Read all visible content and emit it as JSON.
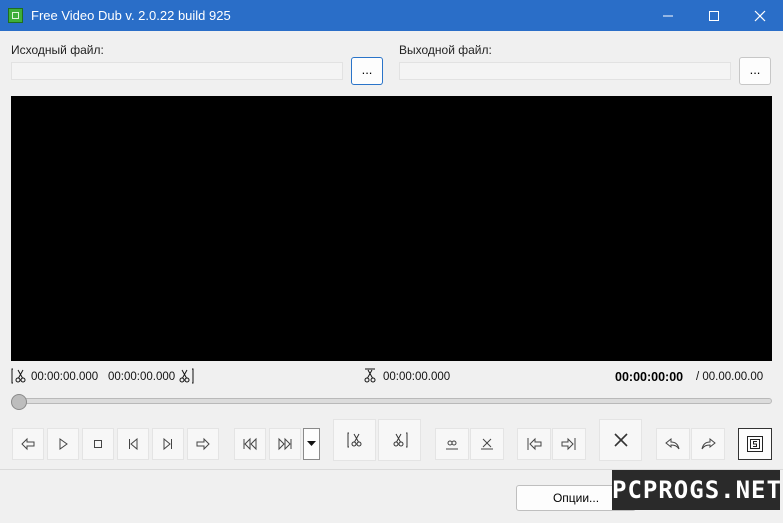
{
  "window": {
    "title": "Free Video Dub  v. 2.0.22 build 925",
    "minimize_icon": "minimize-icon",
    "maximize_icon": "maximize-icon",
    "close_icon": "close-icon"
  },
  "input": {
    "label": "Исходный файл:",
    "value": "",
    "browse_label": "..."
  },
  "output": {
    "label": "Выходной файл:",
    "value": "",
    "browse_label": "..."
  },
  "timecodes": {
    "cut_start": "00:00:00.000",
    "cut_end": "00:00:00.000",
    "marker": "00:00:00.000",
    "current": "00:00:00:00",
    "total": "/ 00.00.00.00"
  },
  "position": {
    "progress": 0
  },
  "toolbar": {
    "icons": [
      "step-back-icon",
      "play-icon",
      "stop-icon",
      "prev-frame-icon",
      "next-frame-icon",
      "step-forward-icon",
      "prev-keyframe-icon",
      "next-keyframe-icon",
      "dropdown-arrow-icon",
      "cut-start-icon",
      "cut-end-icon",
      "marker-set-icon",
      "marker-clear-icon",
      "goto-cut-start-icon",
      "goto-cut-end-icon",
      "delete-icon",
      "undo-icon",
      "redo-icon",
      "save-frame-icon"
    ]
  },
  "footer": {
    "options_label": "Опции...",
    "watermark": "PCPROGS.NET"
  },
  "colors": {
    "titlebar": "#2a6ec8",
    "video_bg": "#000000",
    "window_bg": "#f0f0f0"
  }
}
